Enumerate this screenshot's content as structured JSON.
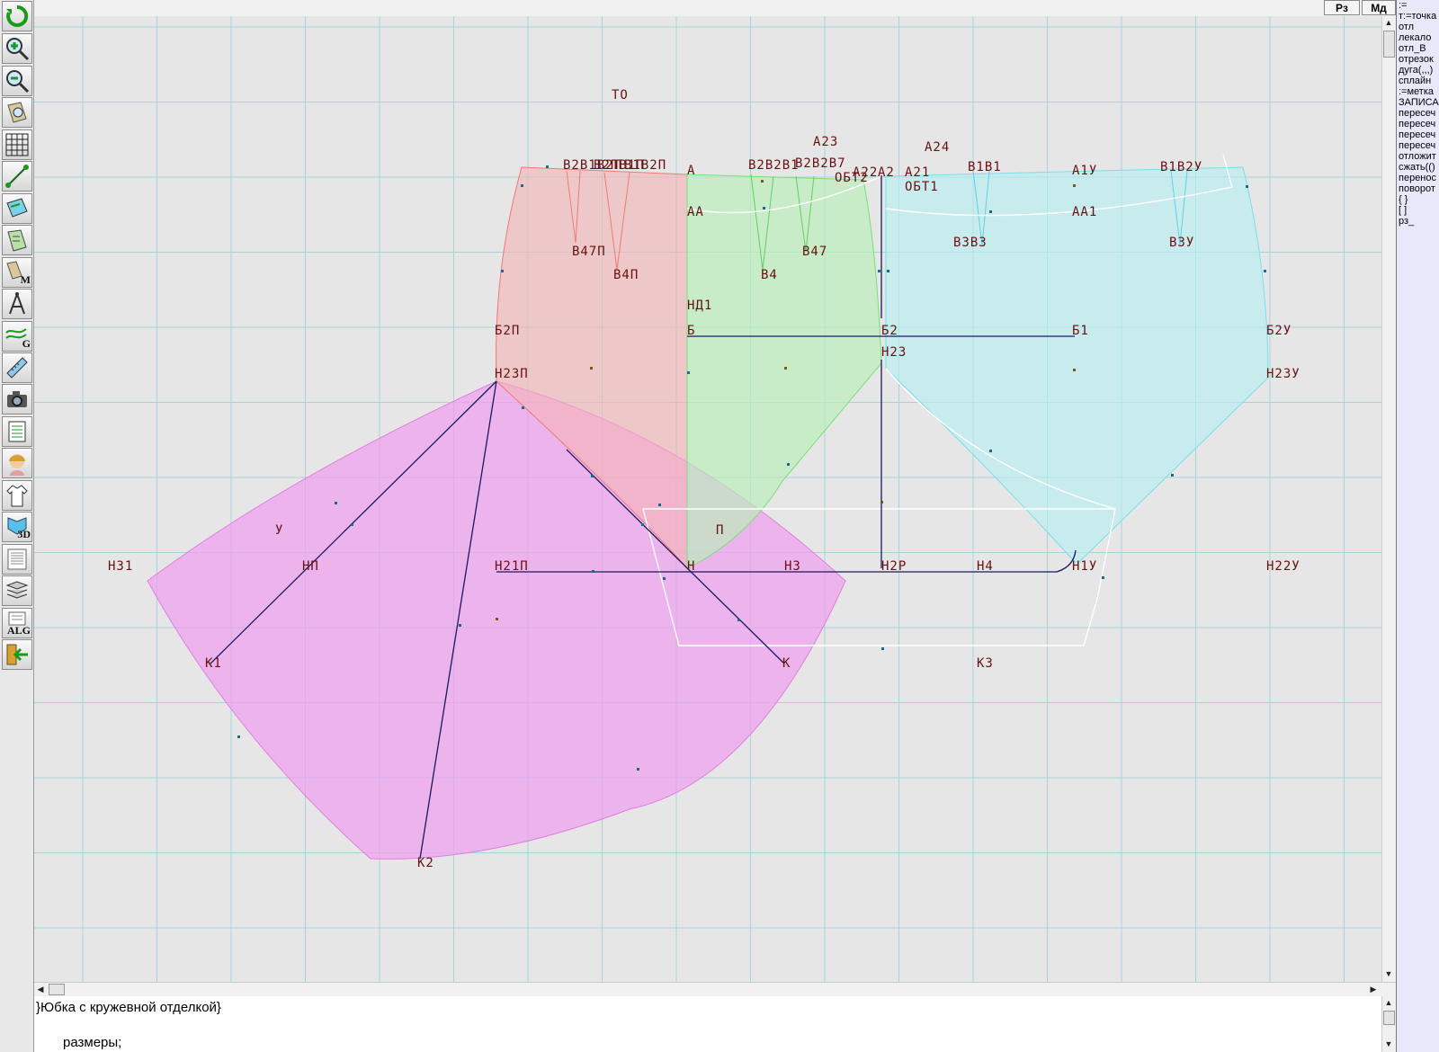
{
  "window": {
    "buttons": [
      {
        "label": "Рз"
      },
      {
        "label": "Мд"
      }
    ]
  },
  "toolbar": {
    "tools": [
      {
        "icon": "refresh-icon"
      },
      {
        "icon": "zoom-in-icon"
      },
      {
        "icon": "zoom-out-icon"
      },
      {
        "icon": "pattern-zoom-icon"
      },
      {
        "icon": "grid-icon"
      },
      {
        "icon": "line-tool-icon"
      },
      {
        "icon": "layout-icon"
      },
      {
        "icon": "pattern-piece-icon"
      },
      {
        "icon": "measurements-icon",
        "text": "M"
      },
      {
        "icon": "compass-icon"
      },
      {
        "icon": "grading-icon",
        "text": "G"
      },
      {
        "icon": "ruler-icon"
      },
      {
        "icon": "camera-icon"
      },
      {
        "icon": "table-icon"
      },
      {
        "icon": "avatar-icon"
      },
      {
        "icon": "garment-icon"
      },
      {
        "icon": "model-3d-icon",
        "text": "3D"
      },
      {
        "icon": "document-icon"
      },
      {
        "icon": "stack-icon"
      },
      {
        "icon": "algorithm-icon",
        "text": "ALG"
      },
      {
        "icon": "exit-icon"
      }
    ]
  },
  "commands": [
    ":=",
    "т:=точка",
    "отл",
    "лекало",
    "отл_В",
    "отрезок",
    "дуга(,,,)",
    "сплайн",
    ":=метка",
    "ЗАПИСА",
    "пересеч",
    "пересеч",
    "пересеч",
    "пересеч",
    "отложит",
    "сжать(()",
    "перенос",
    "поворот",
    "{ }",
    "[ ]",
    "рз_"
  ],
  "editor": {
    "line1": "}Юбка с кружевной отделкой}",
    "line2": "размеры;"
  },
  "drawing": {
    "points": [
      {
        "label": "ТО"
      },
      {
        "label": "В2В1В2П"
      },
      {
        "label": "В2ПВ1П"
      },
      {
        "label": "В1В2П"
      },
      {
        "label": "А"
      },
      {
        "label": "В2В2В1"
      },
      {
        "label": "В2В2В7"
      },
      {
        "label": "А23"
      },
      {
        "label": "А22"
      },
      {
        "label": "ОБТ2"
      },
      {
        "label": "А2"
      },
      {
        "label": "А21"
      },
      {
        "label": "ОБТ1"
      },
      {
        "label": "А24"
      },
      {
        "label": "В1В1"
      },
      {
        "label": "А1У"
      },
      {
        "label": "В1В2У"
      },
      {
        "label": "АА"
      },
      {
        "label": "АА1"
      },
      {
        "label": "В47П"
      },
      {
        "label": "В4П"
      },
      {
        "label": "В4"
      },
      {
        "label": "В47"
      },
      {
        "label": "В3В3"
      },
      {
        "label": "В3У"
      },
      {
        "label": "НД1"
      },
      {
        "label": "Б2П"
      },
      {
        "label": "Б"
      },
      {
        "label": "Б2"
      },
      {
        "label": "Б1"
      },
      {
        "label": "Б2У"
      },
      {
        "label": "Н23"
      },
      {
        "label": "Н23П"
      },
      {
        "label": "Н23У"
      },
      {
        "label": "У"
      },
      {
        "label": "П"
      },
      {
        "label": "Н31"
      },
      {
        "label": "НП"
      },
      {
        "label": "Н21П"
      },
      {
        "label": "Н"
      },
      {
        "label": "Н3"
      },
      {
        "label": "Н2Р"
      },
      {
        "label": "Н4"
      },
      {
        "label": "Н1У"
      },
      {
        "label": "Н22У"
      },
      {
        "label": "К1"
      },
      {
        "label": "К"
      },
      {
        "label": "К3"
      },
      {
        "label": "К2"
      }
    ],
    "colors": {
      "front": "#f4b4b4",
      "side": "#b8f0b8",
      "back": "#b4f0f4",
      "flounce": "#f0a0f0",
      "grid": "#a8d4d8",
      "label": "#6a1010"
    }
  }
}
